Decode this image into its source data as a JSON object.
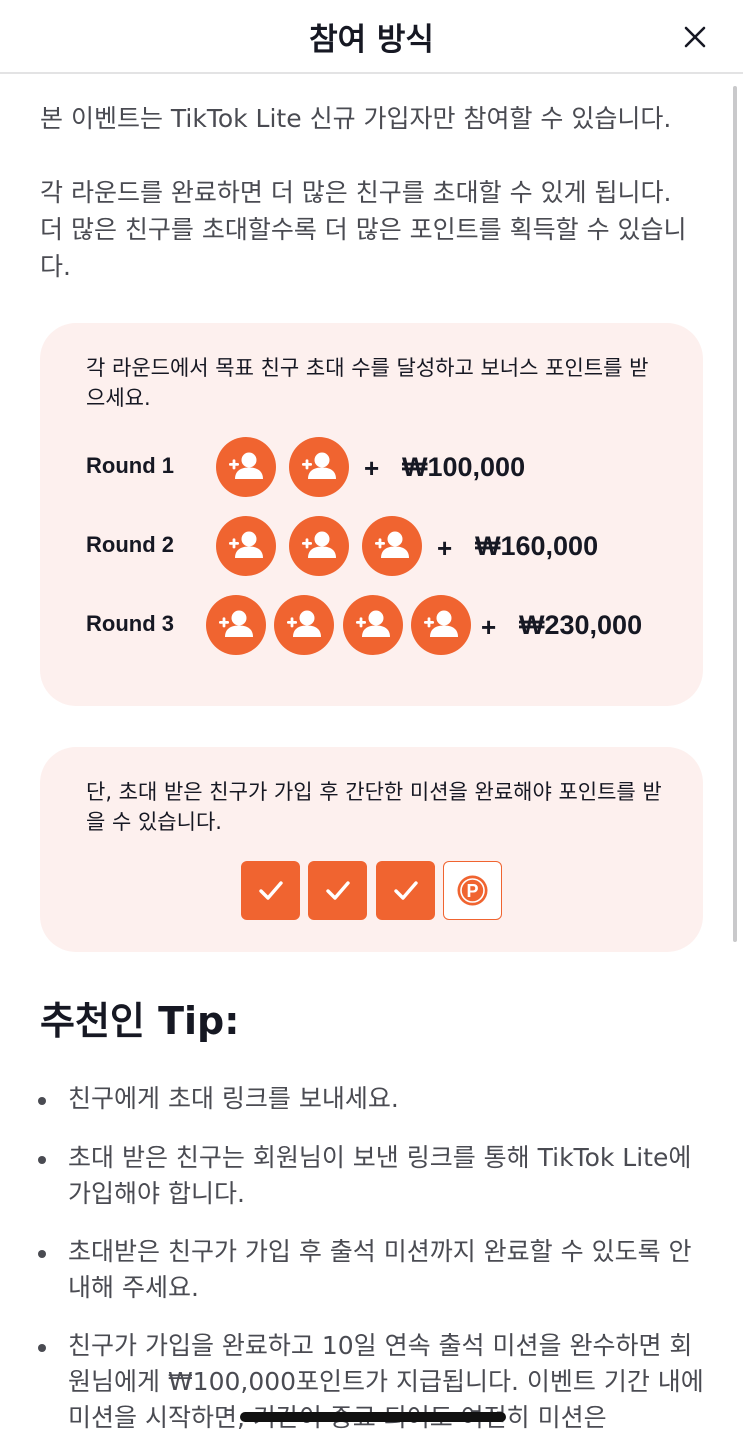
{
  "header": {
    "title": "참여 방식",
    "close_icon": "close-icon"
  },
  "intro": {
    "line1": "본 이벤트는 TikTok Lite 신규 가입자만 참여할 수 있습니다.",
    "line2": "각 라운드를 완료하면 더 많은 친구를 초대할 수 있게 됩니다. 더 많은 친구를 초대할수록 더 많은 포인트를 획득할 수 있습니다."
  },
  "rounds_card": {
    "description": "각 라운드에서 목표 친구 초대 수를 달성하고 보너스 포인트를 받으세요.",
    "rounds": [
      {
        "label": "Round 1",
        "invites": 2,
        "plus": "+",
        "amount": "₩100,000"
      },
      {
        "label": "Round 2",
        "invites": 3,
        "plus": "+",
        "amount": "₩160,000"
      },
      {
        "label": "Round 3",
        "invites": 4,
        "plus": "+",
        "amount": "₩230,000"
      }
    ],
    "icon": "add-friend-icon",
    "accent_color": "#f06430",
    "card_color": "#fdf0ee"
  },
  "mission_card": {
    "description": "단, 초대 받은 친구가 가입 후 간단한 미션을 완료해야 포인트를 받을 수 있습니다.",
    "steps": [
      "checkmark-icon",
      "checkmark-icon",
      "checkmark-icon",
      "points-icon"
    ]
  },
  "tips": {
    "title": "추천인 Tip:",
    "items": [
      "친구에게 초대 링크를 보내세요.",
      "초대 받은 친구는 회원님이 보낸 링크를 통해 TikTok Lite에 가입해야 합니다.",
      "초대받은 친구가 가입 후 출석 미션까지 완료할 수 있도록 안내해 주세요.",
      "친구가 가입을 완료하고 10일 연속 출석 미션을 완수하면 회원님에게 ₩100,000포인트가 지급됩니다. 이벤트 기간 내에 미션을 시작하면, 기간이 종료 되어도 여전히 미션은"
    ]
  }
}
